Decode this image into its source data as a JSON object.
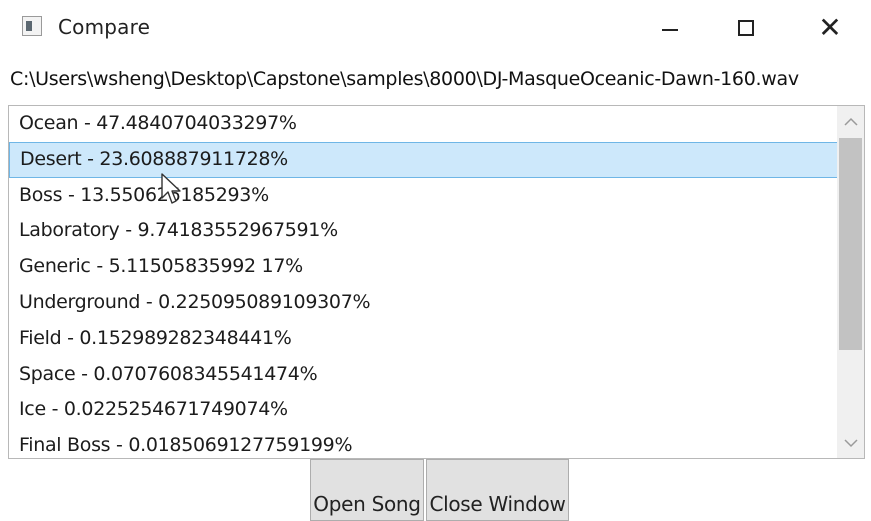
{
  "window": {
    "title": "Compare",
    "controls": {
      "minimize": "minimize",
      "maximize": "maximize",
      "close": "✕"
    }
  },
  "file_path": "C:\\Users\\wsheng\\Desktop\\Capstone\\samples\\8000\\DJ-MasqueOceanic-Dawn-160.wav",
  "results": {
    "items": [
      {
        "label": "Ocean - 47.4840704033297%"
      },
      {
        "label": "Desert - 23.608887911728%",
        "selected": true
      },
      {
        "label": "Boss - 13.550626185293%"
      },
      {
        "label": "Laboratory - 9.74183552967591%"
      },
      {
        "label": "Generic - 5.11505835992 17%"
      },
      {
        "label": "Underground - 0.225095089109307%"
      },
      {
        "label": "Field - 0.152989282348441%"
      },
      {
        "label": "Space - 0.0707608345541474%"
      },
      {
        "label": "Ice - 0.0225254671749074%"
      },
      {
        "label": "Final Boss - 0.0185069127759199%"
      }
    ]
  },
  "buttons": {
    "open_song": "Open Song",
    "close_window": "Close Window"
  }
}
